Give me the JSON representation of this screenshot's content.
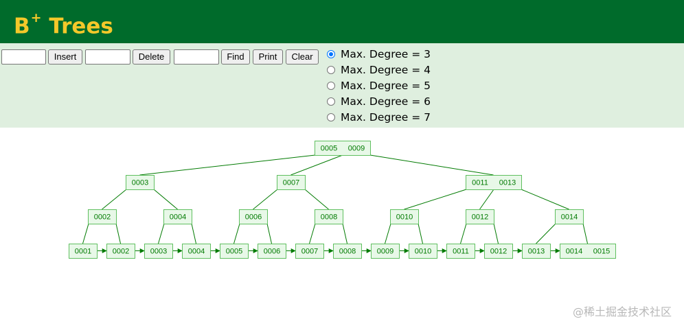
{
  "header": {
    "title": "B",
    "title_sup": "+",
    "title_rest": " Trees"
  },
  "controls": {
    "insert_label": "Insert",
    "delete_label": "Delete",
    "find_label": "Find",
    "print_label": "Print",
    "clear_label": "Clear",
    "insert_value": "",
    "delete_value": "",
    "find_value": ""
  },
  "degree_options": [
    {
      "label": "Max. Degree = 3",
      "checked": true
    },
    {
      "label": "Max. Degree = 4",
      "checked": false
    },
    {
      "label": "Max. Degree = 5",
      "checked": false
    },
    {
      "label": "Max. Degree = 6",
      "checked": false
    },
    {
      "label": "Max. Degree = 7",
      "checked": false
    }
  ],
  "tree": {
    "root": [
      "0005",
      "0009"
    ],
    "level1": [
      [
        "0003"
      ],
      [
        "0007"
      ],
      [
        "0011",
        "0013"
      ]
    ],
    "level2": [
      [
        "0002"
      ],
      [
        "0004"
      ],
      [
        "0006"
      ],
      [
        "0008"
      ],
      [
        "0010"
      ],
      [
        "0012"
      ],
      [
        "0014"
      ]
    ],
    "leaves": [
      [
        "0001"
      ],
      [
        "0002"
      ],
      [
        "0003"
      ],
      [
        "0004"
      ],
      [
        "0005"
      ],
      [
        "0006"
      ],
      [
        "0007"
      ],
      [
        "0008"
      ],
      [
        "0009"
      ],
      [
        "0010"
      ],
      [
        "0011"
      ],
      [
        "0012"
      ],
      [
        "0013"
      ],
      [
        "0014",
        "0015"
      ]
    ]
  },
  "colors": {
    "header": "#006b2b",
    "title": "#f4c82a",
    "panel": "#dfefdf",
    "tree": "#007a00"
  },
  "watermark": "@稀土掘金技术社区"
}
